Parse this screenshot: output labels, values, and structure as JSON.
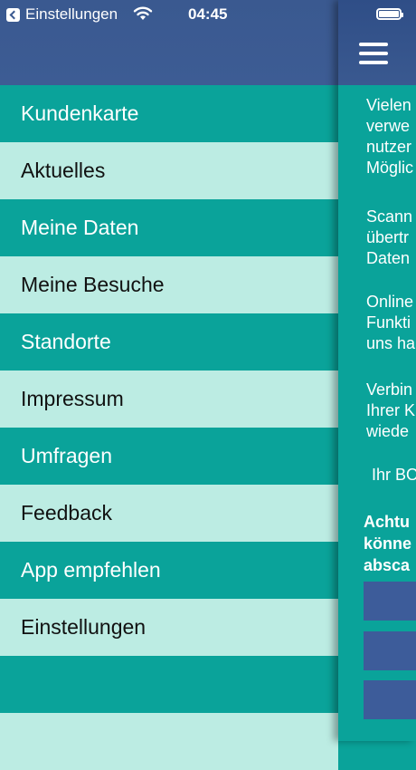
{
  "status_bar": {
    "back_label": "Einstellungen",
    "time": "04:45"
  },
  "menu": {
    "items": [
      {
        "label": "Kundenkarte",
        "style": "dark"
      },
      {
        "label": "Aktuelles",
        "style": "light"
      },
      {
        "label": "Meine Daten",
        "style": "dark"
      },
      {
        "label": "Meine Besuche",
        "style": "light"
      },
      {
        "label": "Standorte",
        "style": "dark"
      },
      {
        "label": "Impressum",
        "style": "light"
      },
      {
        "label": "Umfragen",
        "style": "dark"
      },
      {
        "label": "Feedback",
        "style": "light"
      },
      {
        "label": "App empfehlen",
        "style": "dark"
      },
      {
        "label": "Einstellungen",
        "style": "light"
      },
      {
        "label": "",
        "style": "dark"
      },
      {
        "label": "",
        "style": "light"
      }
    ]
  },
  "main": {
    "paragraphs": [
      [
        "Vielen",
        "verwe",
        "nutzer",
        "Möglic"
      ],
      [
        "Scann",
        "übertr",
        "Daten"
      ],
      [
        "Online",
        "Funkti",
        "uns ha"
      ],
      [
        "Verbin",
        "Ihrer K",
        "wiede"
      ]
    ],
    "signoff": "Ihr BO",
    "warning": [
      "Achtu",
      "könne",
      "absca"
    ]
  },
  "colors": {
    "header_blue": "#3a5990",
    "teal_dark": "#0aa39a",
    "teal_light": "#bcece3",
    "button_blue": "#3d5c9a"
  }
}
